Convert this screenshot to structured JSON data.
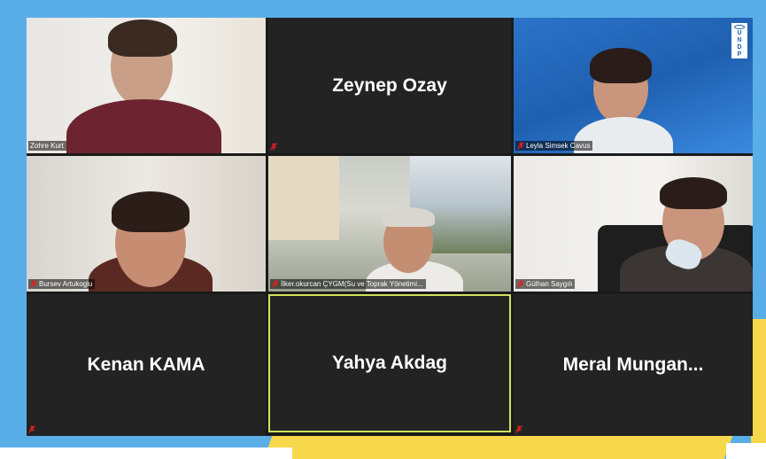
{
  "meeting": {
    "participants": [
      {
        "id": "zohre",
        "name": "Zohre Kurt",
        "video": true,
        "muted": false,
        "active": false
      },
      {
        "id": "zeynep",
        "name": "Zeynep Ozay",
        "video": false,
        "muted": true,
        "active": false
      },
      {
        "id": "leyla",
        "name": "Leyla Simsek Cavus",
        "video": true,
        "muted": true,
        "active": false
      },
      {
        "id": "bursev",
        "name": "Bursev Artukoglu",
        "video": true,
        "muted": true,
        "active": false
      },
      {
        "id": "ilker",
        "name": "İlker.okurcan ÇYGM(Su ve Toprak Yönetimi...",
        "video": true,
        "muted": true,
        "active": false
      },
      {
        "id": "gulhan",
        "name": "Gülhan Saygılı",
        "video": true,
        "muted": true,
        "active": false
      },
      {
        "id": "kenan",
        "name": "Kenan KAMA",
        "video": false,
        "muted": true,
        "active": false
      },
      {
        "id": "yahya",
        "name": "Yahya Akdag",
        "video": false,
        "muted": false,
        "active": true
      },
      {
        "id": "meral",
        "name": "Meral  Mungan...",
        "video": false,
        "muted": true,
        "active": false
      }
    ]
  },
  "logo": {
    "text_lines": [
      "U",
      "N",
      "D",
      "P"
    ]
  },
  "colors": {
    "background": "#5aaee8",
    "tile_bg": "#232323",
    "active_border": "#cfe35a",
    "muted_icon": "#e02020",
    "accent_yellow": "#f6d84a"
  },
  "icons": {
    "muted": "mic-muted-icon"
  }
}
